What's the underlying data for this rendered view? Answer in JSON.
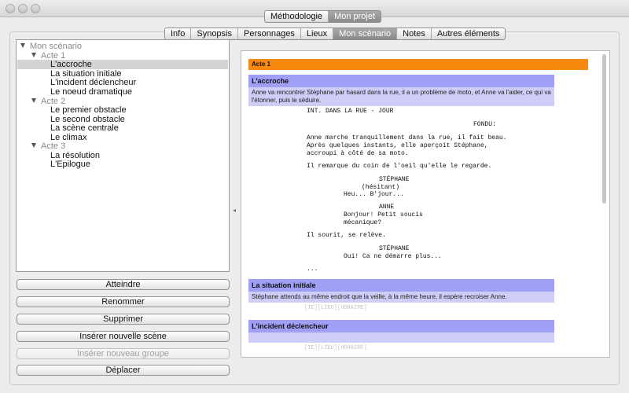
{
  "top_tabs": [
    {
      "label": "Méthodologie",
      "selected": false
    },
    {
      "label": "Mon projet",
      "selected": true
    }
  ],
  "sub_tabs": [
    {
      "label": "Info",
      "selected": false
    },
    {
      "label": "Synopsis",
      "selected": false
    },
    {
      "label": "Personnages",
      "selected": false
    },
    {
      "label": "Lieux",
      "selected": false
    },
    {
      "label": "Mon scénario",
      "selected": true
    },
    {
      "label": "Notes",
      "selected": false
    },
    {
      "label": "Autres éléments",
      "selected": false
    }
  ],
  "tree": {
    "root": "Mon scénario",
    "acts": [
      {
        "label": "Acte 1",
        "scenes": [
          "L'accroche",
          "La situation initiale",
          "L'incident déclencheur",
          "Le noeud dramatique"
        ]
      },
      {
        "label": "Acte 2",
        "scenes": [
          "Le premier obstacle",
          "Le second obstacle",
          "La scène centrale",
          "Le climax"
        ]
      },
      {
        "label": "Acte 3",
        "scenes": [
          "La résolution",
          "L'Epilogue"
        ]
      }
    ],
    "selected": "L'accroche"
  },
  "buttons": {
    "atteindre": "Atteindre",
    "renommer": "Renommer",
    "supprimer": "Supprimer",
    "inserer_scene": "Insérer nouvelle scène",
    "inserer_groupe": "Insérer nouveau groupe",
    "deplacer": "Déplacer"
  },
  "document": {
    "act_header": "Acte 1",
    "scene1": {
      "title": "L'accroche",
      "description": "Anne va rencontrer Stéphane par hasard dans la rue, il a un problème de moto, et Anne va l'aider, ce qui va l'étonner, puis le séduire.",
      "script": {
        "heading": "INT. DANS LA RUE - JOUR",
        "transition": "FONDU:",
        "action1": [
          "Anne marche tranquillement dans la rue, il fait beau.",
          "Après quelques instants, elle aperçoit Stéphane,",
          "accroupi à côté de sa moto."
        ],
        "action2": "Il remarque du coin de l'oeil qu'elle le regarde.",
        "char1": "STÉPHANE",
        "paren1": "(hésitant)",
        "dial1": "Heu... B'jour...",
        "char2": "ANNE",
        "dial2": [
          "Bonjour! Petit soucis",
          "mécanique?"
        ],
        "action3": "Il sourit, se relève.",
        "char3": "STÉPHANE",
        "dial3": "Oui! Ca ne démarre plus...",
        "ellipsis": "..."
      }
    },
    "scene2": {
      "title": "La situation initiale",
      "description": "Stéphane attends au même endroit que la veille, à la même heure, il espère recroiser Anne.",
      "placeholder": "[IE][LIEU][HORAIRE]"
    },
    "scene3": {
      "title": "L'incident déclencheur",
      "description": "",
      "placeholder": "[IE][LIEU][HORAIRE]"
    }
  },
  "colors": {
    "act_header": "#f7890f",
    "scene_header": "#9f9ff6",
    "scene_desc": "#cdcdf8",
    "tab_selected": "#8f8f8f"
  },
  "icons": [
    "close-icon",
    "minimize-icon",
    "zoom-icon",
    "disclosure-triangle-icon",
    "splitter-handle-icon"
  ]
}
